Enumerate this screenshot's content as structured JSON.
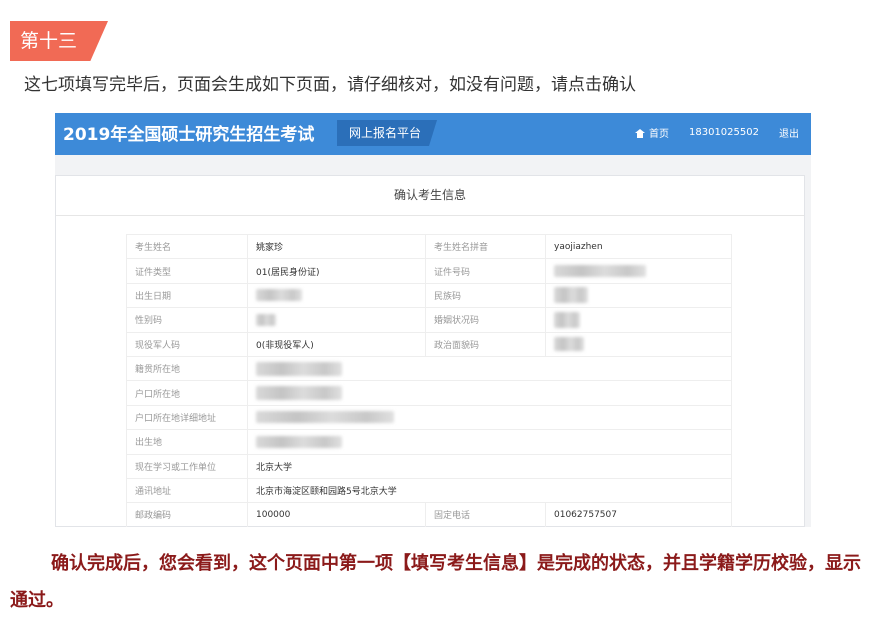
{
  "article": {
    "step_badge": "第十三",
    "intro": "这七项填写完毕后，页面会生成如下页面，请仔细核对，如没有问题，请点击确认",
    "conclusion": "确认完成后，您会看到，这个页面中第一项【填写考生信息】是完成的状态，并且学籍学历校验，显示通过。"
  },
  "screenshot": {
    "site_title": "2019年全国硕士研究生招生考试",
    "platform_tag": "网上报名平台",
    "nav": {
      "home": "首页",
      "phone": "18301025502",
      "logout": "退出"
    },
    "panel_title": "确认考生信息",
    "rows": [
      {
        "label": "考生姓名",
        "value": "姚家珍",
        "label2": "考生姓名拼音",
        "value2": "yaojiazhen"
      },
      {
        "label": "证件类型",
        "value": "01(居民身份证)",
        "label2": "证件号码",
        "value2": ""
      },
      {
        "label": "出生日期",
        "value": "",
        "label2": "民族码",
        "value2": ""
      },
      {
        "label": "性别码",
        "value": "",
        "label2": "婚姻状况码",
        "value2": ""
      },
      {
        "label": "现役军人码",
        "value": "0(非现役军人)",
        "label2": "政治面貌码",
        "value2": ""
      },
      {
        "label": "籍贯所在地",
        "value": ""
      },
      {
        "label": "户口所在地",
        "value": ""
      },
      {
        "label": "户口所在地详细地址",
        "value": ""
      },
      {
        "label": "出生地",
        "value": ""
      },
      {
        "label": "现在学习或工作单位",
        "value": "北京大学"
      },
      {
        "label": "通讯地址",
        "value": "北京市海淀区颐和园路5号北京大学"
      },
      {
        "label": "邮政编码",
        "value": "100000",
        "label2": "固定电话",
        "value2": "01062757507"
      }
    ],
    "colors": {
      "header_blue": "#3d8ad8",
      "badge_red": "#f16a55",
      "conclusion_text": "#8b1a1a"
    }
  }
}
